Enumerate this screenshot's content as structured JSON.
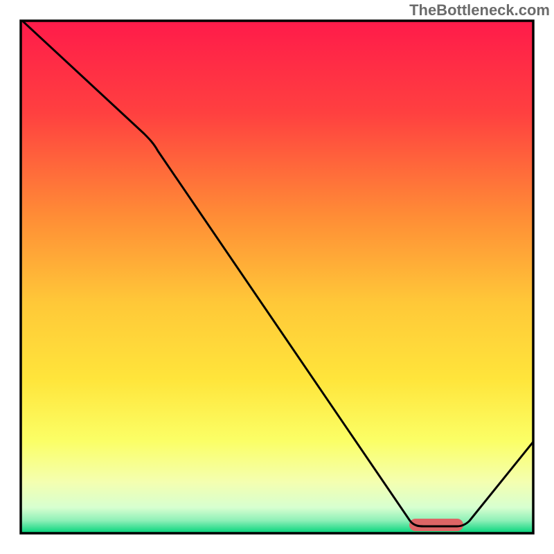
{
  "watermark": "TheBottleneck.com",
  "colors": {
    "gradient_top": "#ff1b4a",
    "gradient_mid_upper": "#ff8c36",
    "gradient_mid": "#ffe53b",
    "gradient_lower": "#faffb3",
    "gradient_bottom": "#00d37a",
    "curve": "#000000",
    "marker": "#dd6565",
    "border": "#000000",
    "watermark": "#6b6b6b"
  },
  "chart_data": {
    "type": "line",
    "title": "",
    "xlabel": "",
    "ylabel": "",
    "xlim": [
      0,
      100
    ],
    "ylim": [
      0,
      100
    ],
    "x": [
      0,
      24,
      77,
      85,
      100
    ],
    "values": [
      100,
      78,
      1.5,
      1.5,
      18
    ],
    "marker_segment": {
      "x_start": 77,
      "x_end": 85,
      "y": 1.5
    },
    "legend": false,
    "grid": false
  }
}
